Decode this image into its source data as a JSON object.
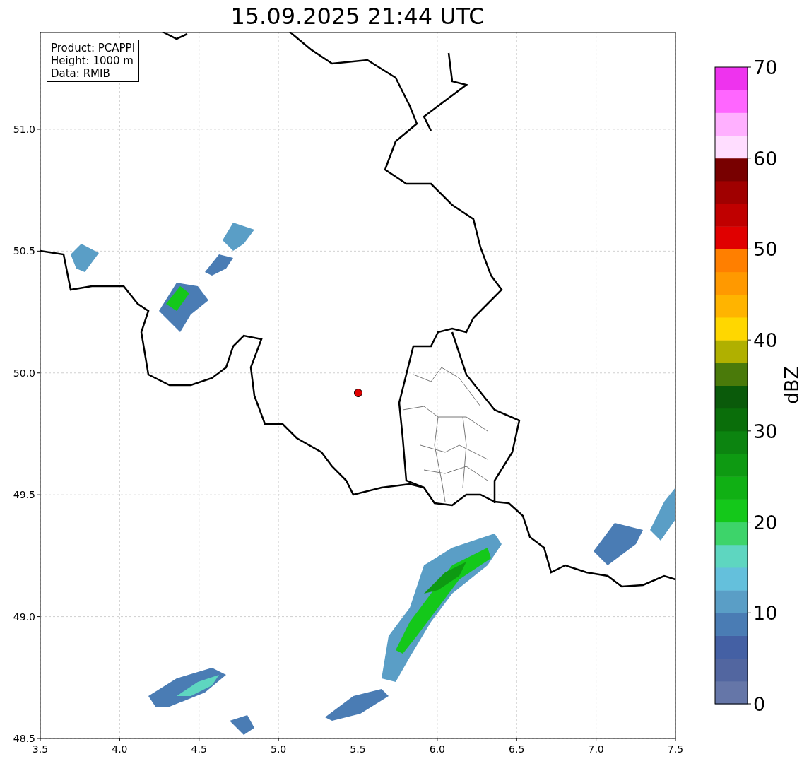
{
  "title": "15.09.2025 21:44 UTC",
  "info_box": [
    "Product: PCAPPI",
    "Height: 1000 m",
    "Data: RMIB"
  ],
  "map": {
    "x_ticks": [
      "3.5",
      "4.0",
      "4.5",
      "5.0",
      "5.5",
      "6.0",
      "6.5",
      "7.0",
      "7.5"
    ],
    "y_ticks": [
      "51.0",
      "50.5",
      "50.0",
      "49.5",
      "49.0",
      "48.5"
    ]
  },
  "colorbar": {
    "label": "dBZ",
    "ticks": [
      "70",
      "60",
      "50",
      "40",
      "30",
      "20",
      "10",
      "0"
    ]
  }
}
